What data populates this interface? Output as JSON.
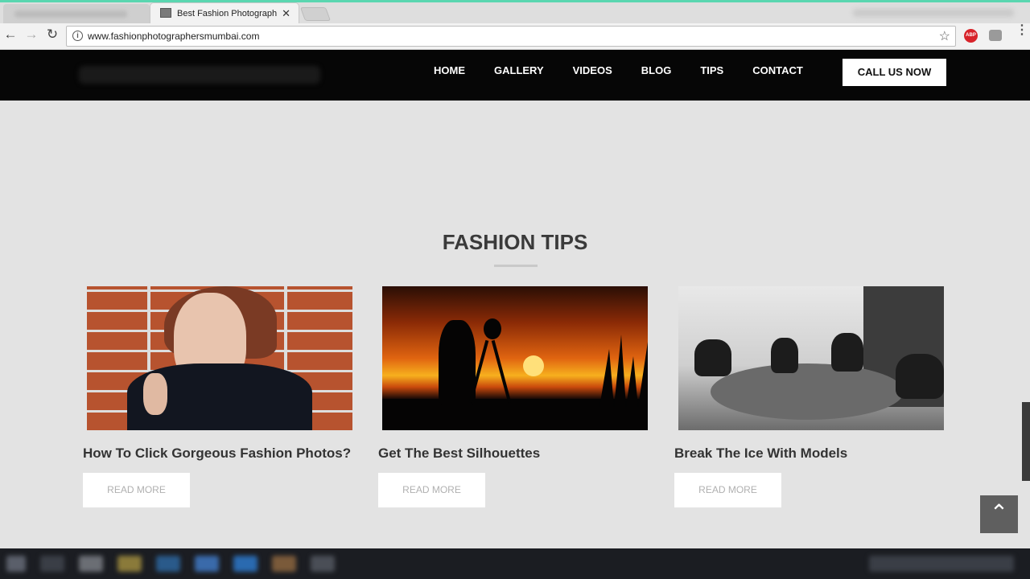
{
  "browser": {
    "tab_title": "Best Fashion Photograph",
    "tab_close": "✕",
    "url": "www.fashionphotographersmumbai.com",
    "back_glyph": "←",
    "forward_glyph": "→",
    "reload_glyph": "↻",
    "star_glyph": "☆",
    "abp_label": "ABP",
    "menu_glyph": "⋮",
    "info_glyph": "i"
  },
  "site": {
    "nav": [
      "HOME",
      "GALLERY",
      "VIDEOS",
      "BLOG",
      "TIPS",
      "CONTACT"
    ],
    "call_button": "CALL US NOW",
    "section_title": "FASHION TIPS",
    "cards": [
      {
        "title": "How To Click Gorgeous Fashion Photos?",
        "button": "READ MORE",
        "image": "portrait-brick-wall"
      },
      {
        "title": "Get The Best Silhouettes",
        "button": "READ MORE",
        "image": "sunset-photographer-silhouette"
      },
      {
        "title": "Break The Ice With Models",
        "button": "READ MORE",
        "image": "black-and-white-fashion-shoot"
      }
    ],
    "back_to_top_glyph": "⌃"
  },
  "colors": {
    "header_bg": "#060606",
    "page_bg": "#e3e3e3",
    "accent_strip": "#5ad6b0"
  }
}
